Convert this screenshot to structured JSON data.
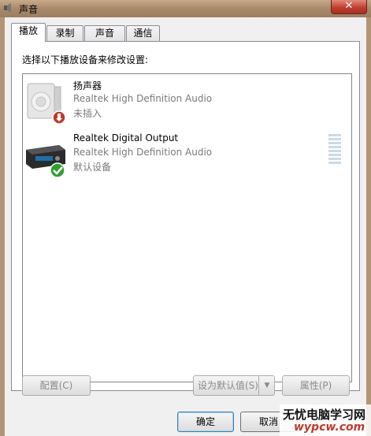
{
  "window": {
    "title": "声音",
    "close_symbol": "✕"
  },
  "tabs": [
    {
      "label": "播放",
      "active": true
    },
    {
      "label": "录制",
      "active": false
    },
    {
      "label": "声音",
      "active": false
    },
    {
      "label": "通信",
      "active": false
    }
  ],
  "instruction": "选择以下播放设备来修改设置:",
  "devices": [
    {
      "name": "扬声器",
      "description": "Realtek High Definition Audio",
      "status": "未插入",
      "icon": "speaker-icon",
      "badge": "unplugged-badge-icon"
    },
    {
      "name": "Realtek Digital Output",
      "description": "Realtek High Definition Audio",
      "status": "默认设备",
      "icon": "digital-output-icon",
      "badge": "default-check-icon"
    }
  ],
  "buttons": {
    "configure": "配置(C)",
    "set_default": "设为默认值(S)",
    "properties": "属性(P)",
    "ok": "确定",
    "cancel": "取消"
  },
  "watermark": {
    "title": "无忧电脑学习网",
    "url": "wypcw.com"
  },
  "colors": {
    "title_bar": "#a88a6a",
    "close_button": "#c0392b",
    "default_check": "#2fa02f",
    "unplugged_badge": "#c0392b"
  }
}
